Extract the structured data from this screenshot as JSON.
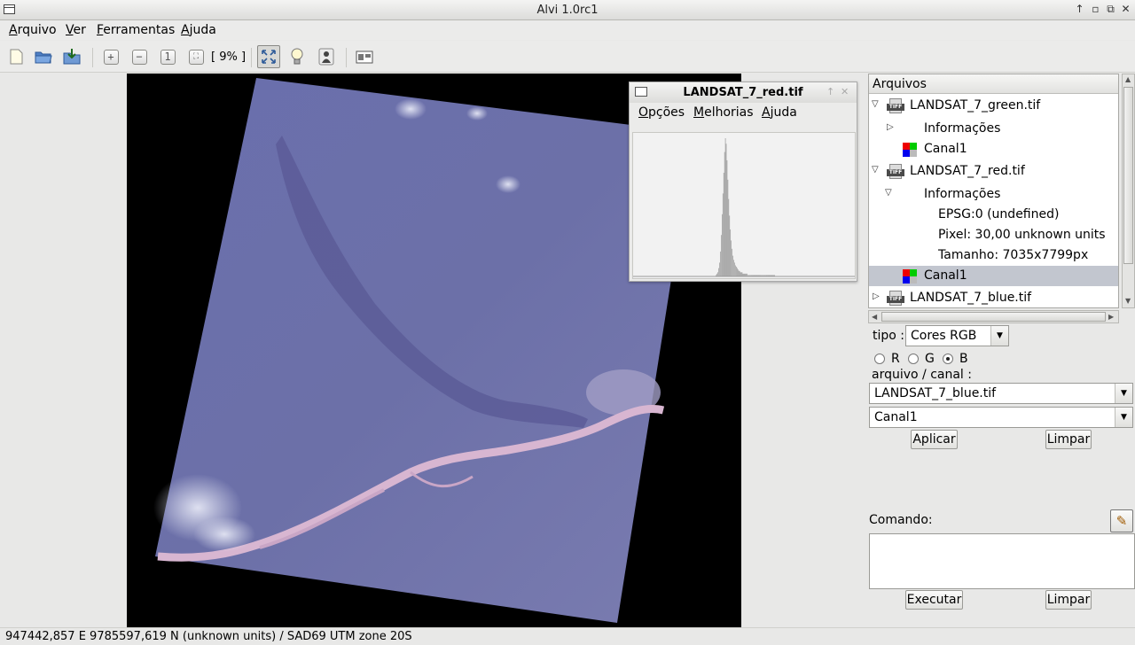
{
  "window": {
    "title": "Alvi 1.0rc1"
  },
  "menubar": {
    "items": [
      "Arquivo",
      "Ver",
      "Ferramentas",
      "Ajuda"
    ]
  },
  "toolbar": {
    "zoom_text": "[ 9% ]"
  },
  "histogram_window": {
    "title": "LANDSAT_7_red.tif",
    "menu": [
      "Opções",
      "Melhorias",
      "Ajuda"
    ],
    "bins": [
      0,
      0,
      0,
      0,
      0,
      0,
      0,
      0,
      0,
      0,
      0,
      0,
      0,
      0,
      0,
      0,
      0,
      0,
      0,
      0,
      0,
      0,
      0,
      0,
      0,
      0,
      0,
      0,
      0,
      0,
      0,
      0,
      0,
      0,
      0,
      0,
      0,
      0,
      0,
      0,
      0,
      0,
      0,
      0,
      0,
      0,
      0,
      0,
      0,
      0,
      0,
      0,
      0,
      0,
      0,
      0,
      0,
      0,
      0,
      0,
      0,
      0,
      0,
      0,
      0,
      0,
      0,
      0,
      0,
      0,
      0,
      0,
      0,
      0,
      0,
      0,
      0,
      0,
      0,
      0,
      0,
      0,
      0,
      0,
      0,
      0,
      0,
      0,
      0,
      0,
      0,
      0,
      0,
      0,
      0,
      0,
      0,
      0,
      0,
      1,
      2,
      3,
      6,
      10,
      18,
      30,
      45,
      60,
      75,
      90,
      100,
      96,
      84,
      70,
      56,
      44,
      34,
      26,
      20,
      15,
      12,
      10,
      8,
      7,
      6,
      5,
      4,
      4,
      3,
      3,
      3,
      2,
      2,
      2,
      2,
      2,
      2,
      1,
      1,
      1,
      1,
      1,
      1,
      1,
      1,
      1,
      1,
      1,
      1,
      1,
      1,
      1,
      1,
      1,
      1,
      1,
      1,
      1,
      1,
      1,
      1,
      1,
      1,
      1,
      1,
      1,
      1,
      1,
      1,
      1,
      0,
      0,
      0,
      0,
      0,
      0,
      0,
      0,
      0,
      0,
      0,
      0,
      0,
      0,
      0,
      0,
      0,
      0,
      0,
      0,
      0,
      0,
      0,
      0,
      0,
      0,
      0,
      0,
      0,
      0,
      0,
      0,
      0,
      0,
      0,
      0,
      0,
      0,
      0,
      0,
      0,
      0,
      0,
      0,
      0,
      0,
      0,
      0,
      0,
      0,
      0,
      0,
      0,
      0,
      0,
      0,
      0,
      0,
      0,
      0,
      0,
      0,
      0,
      0,
      0,
      0,
      0,
      0,
      0,
      0,
      0,
      0,
      0,
      0,
      0,
      0,
      0,
      0,
      0,
      0,
      0,
      0,
      0,
      0,
      0,
      0,
      0,
      0,
      0,
      0,
      0,
      0,
      0,
      0,
      0
    ]
  },
  "files_panel": {
    "header": "Arquivos",
    "items": {
      "green_file": "LANDSAT_7_green.tif",
      "green_info": "Informações",
      "green_channel": "Canal1",
      "red_file": "LANDSAT_7_red.tif",
      "red_info": "Informações",
      "red_epsg": "EPSG:0 (undefined)",
      "red_pixel": "Pixel: 30,00 unknown units",
      "red_size": "Tamanho: 7035x7799px",
      "red_channel": "Canal1",
      "blue_file": "LANDSAT_7_blue.tif"
    }
  },
  "composition": {
    "type_label": "tipo :",
    "type_value": "Cores RGB",
    "radios": [
      "R",
      "G",
      "B"
    ],
    "selected_radio": "B",
    "file_channel_label": "arquivo / canal :",
    "file_value": "LANDSAT_7_blue.tif",
    "channel_value": "Canal1",
    "apply_label": "Aplicar",
    "clear_label": "Limpar"
  },
  "command": {
    "label": "Comando:",
    "execute_label": "Executar",
    "clear_label": "Limpar"
  },
  "statusbar": {
    "text": "947442,857 E 9785597,619 N (unknown units) / SAD69 UTM zone 20S"
  },
  "colors": {
    "selection": "#c2c6cf",
    "satellite_tint": "#6b6ea8",
    "river": "#d9b8d3"
  }
}
